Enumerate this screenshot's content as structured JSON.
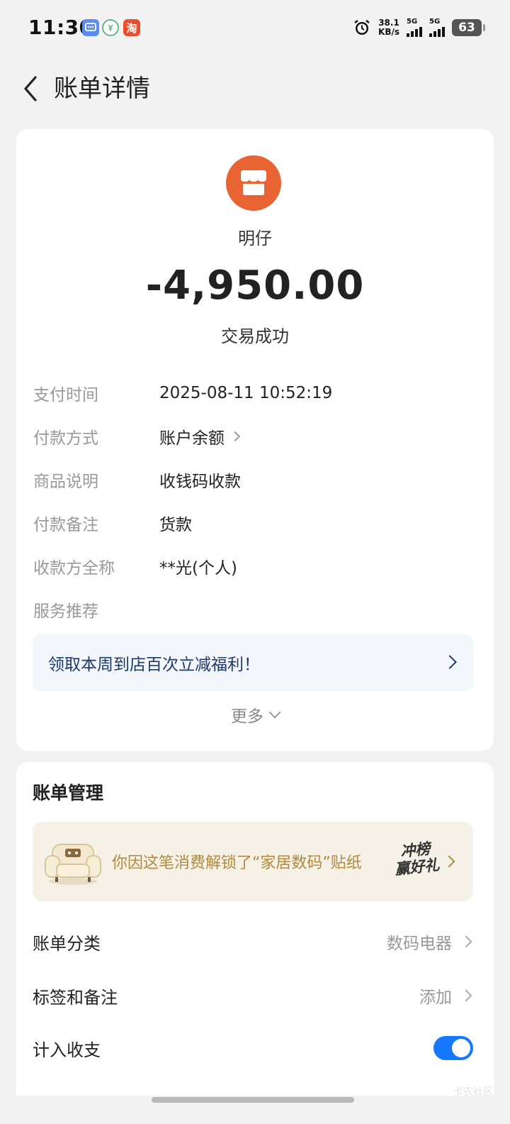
{
  "status_bar": {
    "time": "11:30",
    "net_speed_value": "38.1",
    "net_speed_unit": "KB/s",
    "signal1_label": "5G",
    "signal2_label": "5G",
    "battery": "63",
    "app3_icon_text": "淘"
  },
  "nav": {
    "title": "账单详情"
  },
  "transaction": {
    "merchant_name": "明仔",
    "amount": "-4,950.00",
    "status": "交易成功",
    "logo_color": "#e96433"
  },
  "details": [
    {
      "label": "支付时间",
      "value": "2025-08-11 10:52:19"
    },
    {
      "label": "付款方式",
      "value": "账户余额"
    },
    {
      "label": "商品说明",
      "value": "收钱码收款"
    },
    {
      "label": "付款备注",
      "value": "货款"
    },
    {
      "label": "收款方全称",
      "value": "**光(个人)"
    },
    {
      "label": "服务推荐",
      "value": ""
    }
  ],
  "promo": {
    "text": "领取本周到店百次立减福利！"
  },
  "more_label": "更多",
  "bill_management": {
    "title": "账单管理",
    "sticker_text": "你因这笔消费解锁了“家居数码”贴纸",
    "sticker_badge_line1": "冲榜",
    "sticker_badge_line2": "赢好礼",
    "rows": [
      {
        "label": "账单分类",
        "value": "数码电器"
      },
      {
        "label": "标签和备注",
        "value": "添加"
      },
      {
        "label": "计入收支",
        "toggle_on": true
      }
    ]
  },
  "colors": {
    "accent": "#1677ff",
    "merchant_orange": "#e96433",
    "promo_text": "#1d3a6b",
    "sticker_text": "#b08a3e"
  },
  "watermark": "卡农社区"
}
